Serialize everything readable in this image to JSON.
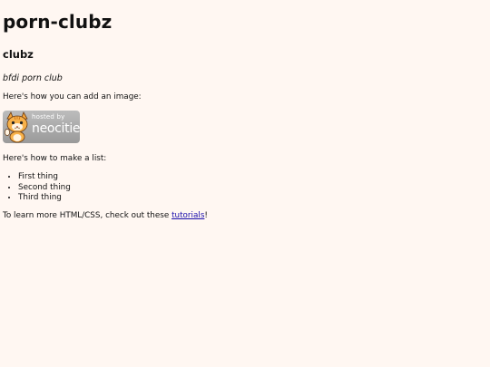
{
  "header": {
    "site_title": "porn-clubz"
  },
  "main": {
    "subtitle": "clubz",
    "tagline": "bfdi porn club",
    "image_intro": "Here's how you can add an image:",
    "badge": {
      "small_text": "hosted by",
      "big_text": "neocities",
      "icon": "neocities-cat-icon"
    },
    "list_intro": "Here's how to make a list:",
    "list_items": [
      "First thing",
      "Second thing",
      "Third thing"
    ],
    "learn_prefix": "To learn more HTML/CSS, check out these ",
    "learn_link": "tutorials",
    "learn_suffix": "!"
  },
  "colors": {
    "background": "#fff7f2",
    "link": "#1a0dab",
    "badge": "#a8a8a8"
  }
}
